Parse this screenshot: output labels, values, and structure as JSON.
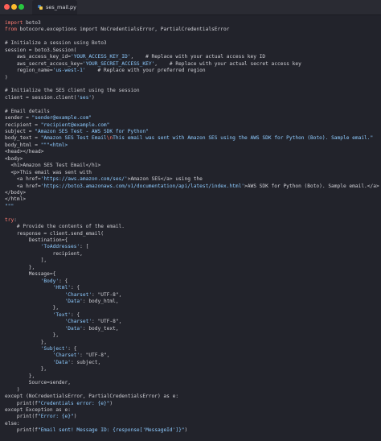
{
  "window": {
    "controls": [
      "close",
      "minimize",
      "maximize"
    ],
    "tab": {
      "label": "ses_mail.py",
      "icon": "python-file-icon"
    }
  },
  "colors": {
    "background": "#22232b",
    "keyword": "#ff7b72",
    "string": "#8ecbff",
    "default": "#d0d0d6"
  },
  "code_lines": [
    [
      {
        "t": "keyword",
        "s": "import"
      },
      {
        "t": "default",
        "s": " boto3"
      }
    ],
    [
      {
        "t": "keyword",
        "s": "from"
      },
      {
        "t": "default",
        "s": " botocore.exceptions import NoCredentialsError, PartialCredentialsError"
      }
    ],
    [],
    [
      {
        "t": "comment",
        "s": "# Initialize a session using Boto3"
      }
    ],
    [
      {
        "t": "default",
        "s": "session = boto3.Session("
      }
    ],
    [
      {
        "t": "default",
        "s": "    aws_access_key_id="
      },
      {
        "t": "string",
        "s": "'YOUR_ACCESS_KEY_ID'"
      },
      {
        "t": "default",
        "s": ",    # Replace with your actual access key ID"
      }
    ],
    [
      {
        "t": "default",
        "s": "    aws_secret_access_key="
      },
      {
        "t": "string",
        "s": "'YOUR_SECRET_ACCESS_KEY'"
      },
      {
        "t": "default",
        "s": ",    # Replace with your actual secret access key"
      }
    ],
    [
      {
        "t": "default",
        "s": "    region_name="
      },
      {
        "t": "string",
        "s": "'us-west-1'"
      },
      {
        "t": "default",
        "s": "    # Replace with your preferred region"
      }
    ],
    [
      {
        "t": "default",
        "s": ")"
      }
    ],
    [],
    [
      {
        "t": "comment",
        "s": "# Initialize the SES client using the session"
      }
    ],
    [
      {
        "t": "default",
        "s": "client = session.client("
      },
      {
        "t": "string",
        "s": "'ses'"
      },
      {
        "t": "default",
        "s": ")"
      }
    ],
    [],
    [
      {
        "t": "comment",
        "s": "# Email details"
      }
    ],
    [
      {
        "t": "default",
        "s": "sender = "
      },
      {
        "t": "string",
        "s": "\"sender@example.com\""
      }
    ],
    [
      {
        "t": "default",
        "s": "recipient = "
      },
      {
        "t": "string",
        "s": "\"recipient@example.com\""
      }
    ],
    [
      {
        "t": "default",
        "s": "subject = "
      },
      {
        "t": "string",
        "s": "\"Amazon SES Test - AWS SDK for Python\""
      }
    ],
    [
      {
        "t": "default",
        "s": "body_text = "
      },
      {
        "t": "string",
        "s": "\"Amazon SES Test Email"
      },
      {
        "t": "escape",
        "s": "\\n"
      },
      {
        "t": "string",
        "s": "This email was sent with Amazon SES using the AWS SDK for Python (Boto). Sample email.\""
      }
    ],
    [
      {
        "t": "default",
        "s": "body_html = "
      },
      {
        "t": "string",
        "s": "\"\"\"<html>"
      }
    ],
    [
      {
        "t": "default",
        "s": "<head></head>"
      }
    ],
    [
      {
        "t": "default",
        "s": "<body>"
      }
    ],
    [
      {
        "t": "default",
        "s": "  <h1>Amazon SES Test Email</h1>"
      }
    ],
    [
      {
        "t": "default",
        "s": "  <p>This email was sent with"
      }
    ],
    [
      {
        "t": "default",
        "s": "    <a href="
      },
      {
        "t": "string",
        "s": "'https://aws.amazon.com/ses/'"
      },
      {
        "t": "default",
        "s": ">Amazon SES</a> using the"
      }
    ],
    [
      {
        "t": "default",
        "s": "    <a href="
      },
      {
        "t": "string",
        "s": "'https://boto3.amazonaws.com/v1/documentation/api/latest/index.html'"
      },
      {
        "t": "default",
        "s": ">AWS SDK for Python (Boto). Sample email.</a>.</p>"
      }
    ],
    [
      {
        "t": "default",
        "s": "</body>"
      }
    ],
    [
      {
        "t": "default",
        "s": "</html>"
      }
    ],
    [
      {
        "t": "string",
        "s": "\"\"\""
      }
    ],
    [],
    [
      {
        "t": "keyword",
        "s": "try"
      },
      {
        "t": "default",
        "s": ":"
      }
    ],
    [
      {
        "t": "comment",
        "s": "    # Provide the contents of the email."
      }
    ],
    [
      {
        "t": "default",
        "s": "    response = client.send_email("
      }
    ],
    [
      {
        "t": "default",
        "s": "        Destination={"
      }
    ],
    [
      {
        "t": "default",
        "s": "            "
      },
      {
        "t": "string",
        "s": "'ToAddresses'"
      },
      {
        "t": "default",
        "s": ": ["
      }
    ],
    [
      {
        "t": "default",
        "s": "                recipient,"
      }
    ],
    [
      {
        "t": "default",
        "s": "            ],"
      }
    ],
    [
      {
        "t": "default",
        "s": "        },"
      }
    ],
    [
      {
        "t": "default",
        "s": "        Message={"
      }
    ],
    [
      {
        "t": "default",
        "s": "            "
      },
      {
        "t": "string",
        "s": "'Body'"
      },
      {
        "t": "default",
        "s": ": {"
      }
    ],
    [
      {
        "t": "default",
        "s": "                "
      },
      {
        "t": "string",
        "s": "'Html'"
      },
      {
        "t": "default",
        "s": ": {"
      }
    ],
    [
      {
        "t": "default",
        "s": "                    "
      },
      {
        "t": "string",
        "s": "'Charset'"
      },
      {
        "t": "default",
        "s": ": \"UTF-8\","
      }
    ],
    [
      {
        "t": "default",
        "s": "                    "
      },
      {
        "t": "string",
        "s": "'Data'"
      },
      {
        "t": "default",
        "s": ": body_html,"
      }
    ],
    [
      {
        "t": "default",
        "s": "                },"
      }
    ],
    [
      {
        "t": "default",
        "s": "                "
      },
      {
        "t": "string",
        "s": "'Text'"
      },
      {
        "t": "default",
        "s": ": {"
      }
    ],
    [
      {
        "t": "default",
        "s": "                    "
      },
      {
        "t": "string",
        "s": "'Charset'"
      },
      {
        "t": "default",
        "s": ": \"UTF-8\","
      }
    ],
    [
      {
        "t": "default",
        "s": "                    "
      },
      {
        "t": "string",
        "s": "'Data'"
      },
      {
        "t": "default",
        "s": ": body_text,"
      }
    ],
    [
      {
        "t": "default",
        "s": "                },"
      }
    ],
    [
      {
        "t": "default",
        "s": "            },"
      }
    ],
    [
      {
        "t": "default",
        "s": "            "
      },
      {
        "t": "string",
        "s": "'Subject'"
      },
      {
        "t": "default",
        "s": ": {"
      }
    ],
    [
      {
        "t": "default",
        "s": "                "
      },
      {
        "t": "string",
        "s": "'Charset'"
      },
      {
        "t": "default",
        "s": ": \"UTF-8\","
      }
    ],
    [
      {
        "t": "default",
        "s": "                "
      },
      {
        "t": "string",
        "s": "'Data'"
      },
      {
        "t": "default",
        "s": ": subject,"
      }
    ],
    [
      {
        "t": "default",
        "s": "            },"
      }
    ],
    [
      {
        "t": "default",
        "s": "        },"
      }
    ],
    [
      {
        "t": "default",
        "s": "        Source=sender,"
      }
    ],
    [
      {
        "t": "default",
        "s": "    )"
      }
    ],
    [
      {
        "t": "default",
        "s": "except (NoCredentialsError, PartialCredentialsError) as e:"
      }
    ],
    [
      {
        "t": "default",
        "s": "    print(f"
      },
      {
        "t": "string",
        "s": "\"Credentials error: {e}\""
      },
      {
        "t": "default",
        "s": ")"
      }
    ],
    [
      {
        "t": "default",
        "s": "except Exception as e:"
      }
    ],
    [
      {
        "t": "default",
        "s": "    print(f"
      },
      {
        "t": "string",
        "s": "\"Error: {e}\""
      },
      {
        "t": "default",
        "s": ")"
      }
    ],
    [
      {
        "t": "default",
        "s": "else:"
      }
    ],
    [
      {
        "t": "default",
        "s": "    print(f"
      },
      {
        "t": "string",
        "s": "\"Email sent! Message ID: {response['MessageId']}\""
      },
      {
        "t": "default",
        "s": ")"
      }
    ]
  ]
}
